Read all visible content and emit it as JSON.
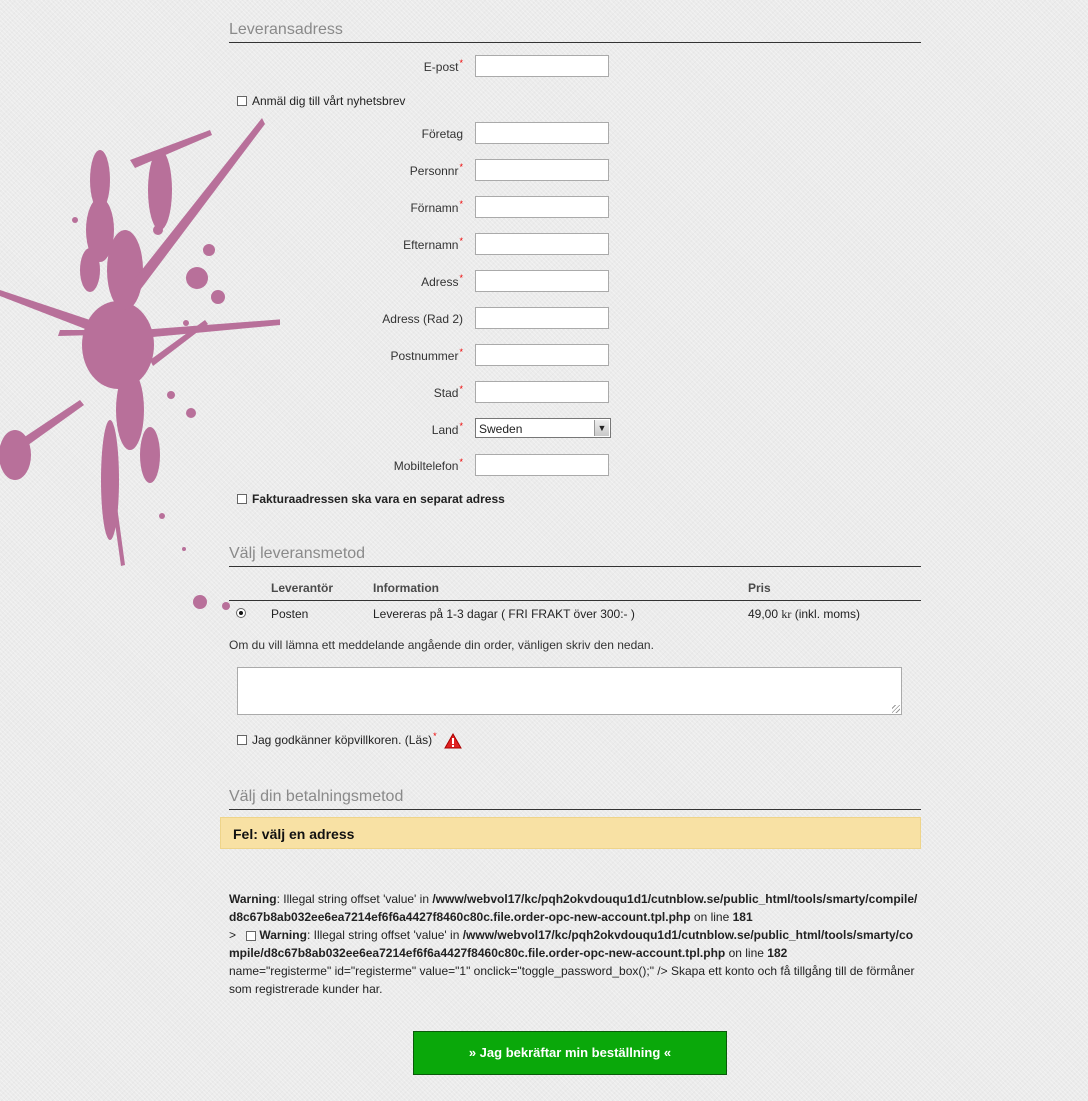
{
  "delivery": {
    "title": "Leveransadress",
    "email_label": "E-post",
    "newsletter_label": "Anmäl dig till vårt nyhetsbrev",
    "fields": [
      {
        "label": "Företag",
        "required": false
      },
      {
        "label": "Personnr",
        "required": true
      },
      {
        "label": "Förnamn",
        "required": true
      },
      {
        "label": "Efternamn",
        "required": true
      },
      {
        "label": "Adress",
        "required": true
      },
      {
        "label": "Adress (Rad 2)",
        "required": false
      },
      {
        "label": "Postnummer",
        "required": true
      },
      {
        "label": "Stad",
        "required": true
      }
    ],
    "country_label": "Land",
    "country_value": "Sweden",
    "mobile_label": "Mobiltelefon",
    "separate_billing_label": "Fakturaadressen ska vara en separat adress"
  },
  "shipping": {
    "title": "Välj leveransmetod",
    "columns": [
      "Leverantör",
      "Information",
      "Pris"
    ],
    "rows": [
      {
        "carrier": "Posten",
        "info": "Levereras på 1-3 dagar ( FRI FRAKT över 300:- )",
        "price": "49,00",
        "currency": "kr",
        "price_suffix": "(inkl. moms)",
        "selected": true
      }
    ]
  },
  "message": {
    "prompt": "Om du vill lämna ett meddelande angående din order, vänligen skriv den nedan.",
    "value": ""
  },
  "terms": {
    "label": "Jag godkänner köpvillkoren.",
    "link": "(Läs)",
    "required": true
  },
  "payment": {
    "title": "Välj din betalningsmetod",
    "error": "Fel: välj en adress"
  },
  "php_warnings": {
    "w1_prefix": "Warning",
    "w1_text": ": Illegal string offset 'value' in ",
    "w1_path": "/www/webvol17/kc/pqh2okvdouqu1d1/cutnblow.se/public_html/tools/smarty/compile/d8c67b8ab032ee6ea7214ef6f6a4427f8460c80c.file.order-opc-new-account.tpl.php",
    "w1_line_text": " on line ",
    "w1_line": "181",
    "w2_lead": ">",
    "w2_prefix": "Warning",
    "w2_text": ": Illegal string offset 'value' in ",
    "w2_path": "/www/webvol17/kc/pqh2okvdouqu1d1/cutnblow.se/public_html/tools/smarty/compile/d8c67b8ab032ee6ea7214ef6f6a4427f8460c80c.file.order-opc-new-account.tpl.php",
    "w2_line_text": " on line ",
    "w2_line": "182",
    "trailing": "name=\"registerme\" id=\"registerme\" value=\"1\" onclick=\"toggle_password_box();\" /> Skapa ett konto och få tillgång till de förmåner som registrerade kunder har."
  },
  "confirm_button": "»  Jag bekräftar min beställning  «",
  "colors": {
    "accent_green": "#0aa80a",
    "error_bg": "#f8e1a4",
    "splash": "#b8709a"
  }
}
